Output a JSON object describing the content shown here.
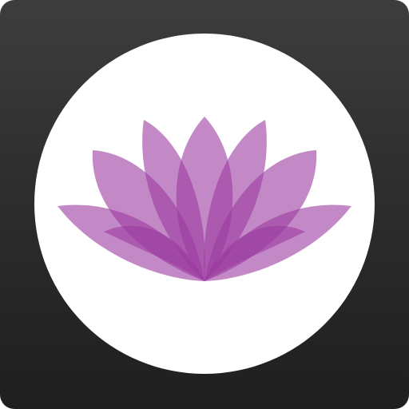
{
  "icon": {
    "name": "lotus-app-icon",
    "background_color_top": "#3d3d3d",
    "background_color_bottom": "#1f1f1f",
    "disc_color": "#ffffff",
    "petal_color": "#9b3aa0",
    "petal_opacity": 0.6
  }
}
